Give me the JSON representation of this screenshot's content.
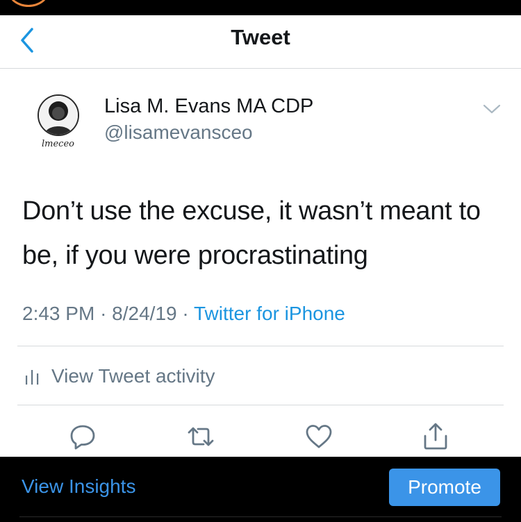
{
  "nav": {
    "title": "Tweet",
    "back_icon": "chevron-left-icon"
  },
  "tweet": {
    "author": {
      "display_name": "Lisa M. Evans MA CDP",
      "handle": "@lisamevansceo",
      "avatar_caption": "lmeceo"
    },
    "text": "Don’t use the excuse, it wasn’t meant to be, if you were procrastinating",
    "time": "2:43 PM",
    "date": "8/24/19",
    "separator": "·",
    "source": "Twitter for iPhone",
    "activity_label": "View Tweet activity"
  },
  "actions": [
    "reply-icon",
    "retweet-icon",
    "like-icon",
    "share-icon"
  ],
  "bottom_bar": {
    "insights_label": "View Insights",
    "promote_label": "Promote"
  },
  "colors": {
    "accent": "#1b95e0",
    "promote": "#3b94e8",
    "text": "#14171a",
    "secondary": "#657786"
  }
}
